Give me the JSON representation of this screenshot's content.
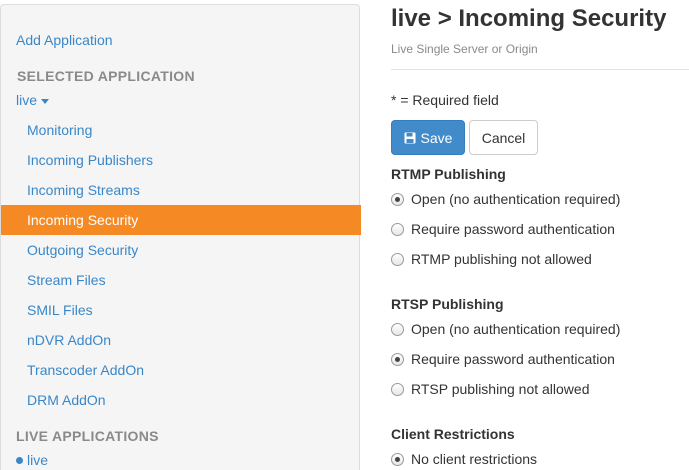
{
  "sidebar": {
    "add_application": "Add Application",
    "selected_heading": "SELECTED APPLICATION",
    "selected_app": "live",
    "items": [
      {
        "label": "Monitoring"
      },
      {
        "label": "Incoming Publishers"
      },
      {
        "label": "Incoming Streams"
      },
      {
        "label": "Incoming Security"
      },
      {
        "label": "Outgoing Security"
      },
      {
        "label": "Stream Files"
      },
      {
        "label": "SMIL Files"
      },
      {
        "label": "nDVR AddOn"
      },
      {
        "label": "Transcoder AddOn"
      },
      {
        "label": "DRM AddOn"
      }
    ],
    "active_item": "Incoming Security",
    "live_heading": "LIVE APPLICATIONS",
    "live_apps": [
      {
        "label": "live"
      }
    ]
  },
  "main": {
    "title": "live > Incoming Security",
    "subtitle": "Live Single Server or Origin",
    "required_note": "* = Required field",
    "save_label": "Save",
    "cancel_label": "Cancel",
    "rtmp": {
      "title": "RTMP Publishing",
      "options": [
        {
          "label": "Open (no authentication required)",
          "checked": true
        },
        {
          "label": "Require password authentication",
          "checked": false
        },
        {
          "label": "RTMP publishing not allowed",
          "checked": false
        }
      ]
    },
    "rtsp": {
      "title": "RTSP Publishing",
      "options": [
        {
          "label": "Open (no authentication required)",
          "checked": false
        },
        {
          "label": "Require password authentication",
          "checked": true
        },
        {
          "label": "RTSP publishing not allowed",
          "checked": false
        }
      ]
    },
    "client": {
      "title": "Client Restrictions",
      "options": [
        {
          "label": "No client restrictions",
          "checked": true
        }
      ]
    }
  },
  "colors": {
    "link": "#3a87c8",
    "active": "#f58a24",
    "primary_button": "#428bca"
  }
}
